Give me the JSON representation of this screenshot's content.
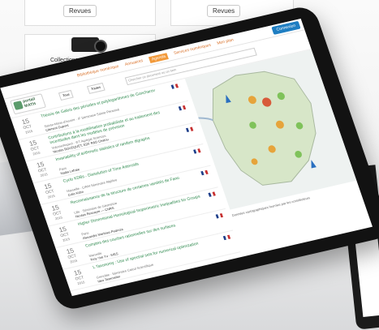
{
  "background": {
    "buttons": [
      "Revues",
      "Revues"
    ],
    "caption": "Collections audiovisuelles"
  },
  "tablet": {
    "nav": [
      "Bibliothèque numérique",
      "Annuaires",
      "Agenda",
      "Services numériques",
      "Mon plan"
    ],
    "login": "Connexion",
    "logo": {
      "line1": "portail",
      "line2": "MATH"
    },
    "search_placeholder": "Chercher un document ou un item",
    "filters": {
      "a": "Tous",
      "b": "Toutes"
    },
    "items": [
      {
        "day": "15",
        "month": "OCT",
        "year": "2015",
        "title": "Théorie de Galois des périodes et polylogarithmes de Goncharov",
        "sub": "Sainte-Marie-d'Issoire · IF Séminaire Sainte-Pérasmé",
        "author": "Clément Dupont"
      },
      {
        "day": "15",
        "month": "OCT",
        "year": "2015",
        "title": "Contributions à la modélisation probabiliste et au traitement des incertitudes dans les modèles de prévision",
        "sub": "Volume/Aspect · IFT Agrégat Sciences",
        "author": "Nicolas BOUSQUET, EDF R&D Chatou"
      },
      {
        "day": "15",
        "month": "OCT",
        "year": "2015",
        "title": "Invariability of arithmetic statistics of random digraphs",
        "sub": "Paris",
        "author": "Nadia Lafrate"
      },
      {
        "day": "15",
        "month": "OCT",
        "year": "2015",
        "title": "Cyclo KDBs - Dissolution of Time Asteroids",
        "sub": "Marseille · CIRM Séminaire Algèbre",
        "author": "Colin Kühn"
      },
      {
        "day": "15",
        "month": "OCT",
        "year": "2015",
        "title": "Reconnaissance de la structure de certaines variétés de Fano",
        "sub": "Lille · Séminaire de Géométrie",
        "author": "Nicolas Ressayre — CNRS"
      },
      {
        "day": "15",
        "month": "OCT",
        "year": "2015",
        "title": "Higher Dimensional Homological Isoperimetric Inequalities for Groups",
        "sub": "Paris",
        "author": "Alexandre Martinez-Pedroza"
      },
      {
        "day": "15",
        "month": "OCT",
        "year": "2015",
        "title": "Comptes des courbes rationnelles sur des surfaces",
        "sub": "Marseille",
        "author": "Tony Yue Yu · IHES"
      },
      {
        "day": "15",
        "month": "OCT",
        "year": "2015",
        "title": "L Taxonomy : Use of spectral sets for numerical optimization",
        "sub": "Grenoble · Séminaire Calcul Scientifique",
        "author": "Ideo Tavernelier"
      }
    ],
    "map_caption": "Données cartographiques fournies par les contributeurs"
  }
}
